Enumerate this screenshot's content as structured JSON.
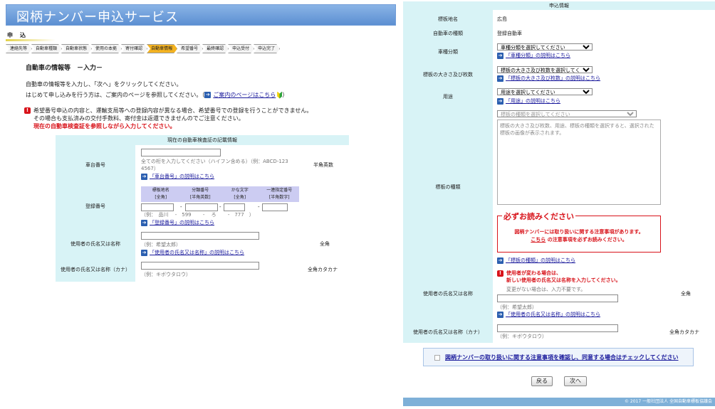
{
  "left": {
    "banner_title": "図柄ナンバー申込サービス",
    "apply_label": "申込",
    "steps": [
      "連絡先等",
      "自動車種類",
      "自動車状態",
      "使用の本拠",
      "寄付確認",
      "自動車情報",
      "希望番号",
      "最終確認",
      "申込受付",
      "申込完了"
    ],
    "active_step_index": 5,
    "heading": "自動車の情報等　－入力－",
    "intro1": "自動車の情報等を入力し、「次へ」をクリックしてください。",
    "intro2": "はじめて申し込みを行う方は、ご案内のページを参照してください。（",
    "intro2_link": "ご案内のページはこちら",
    "warn1": "希望番号申込の内容と、運輸支局等への登録内容が異なる場合、希望番号での登録を行うことができません。",
    "warn2": "その場合も支払済みの交付手数料、寄付金は返還できませんのでご注意ください。",
    "warn3": "現在の自動車検査証を参照しながら入力してください。",
    "form_header": "現在の自動車検査証の記載情報",
    "chassis": {
      "label": "車台番号",
      "value": "",
      "hint": "全ての桁を入力してください（ハイフン含める）（例：ABCD-123",
      "hint2": "4567）",
      "help_link": "「車台番号」の説明はこちら",
      "note": "半角英数"
    },
    "registration": {
      "label": "登録番号",
      "columns": [
        {
          "name": "標板地名",
          "type": "[全角]"
        },
        {
          "name": "分類番号",
          "type": "[半角英数]"
        },
        {
          "name": "かな文字",
          "type": "[全角]"
        },
        {
          "name": "一連指定番号",
          "type": "[半角数字]"
        }
      ],
      "separator": "-",
      "example": "（例：　品川　 -　599　　 -　 ろ　　 -　777　）",
      "help_link": "「登録番号」の説明はこちら"
    },
    "user_name": {
      "label": "使用者の氏名又は名称",
      "example": "（例：希望太郎）",
      "help_link": "「使用者の氏名又は名称」の説明はこちら",
      "note": "全角"
    },
    "user_kana": {
      "label": "使用者の氏名又は名称（カナ）",
      "example": "（例：キボウタロウ）",
      "note": "全角カタカナ"
    }
  },
  "right": {
    "header": "申込情報",
    "plate_region": {
      "label": "標板地名",
      "value": "広島"
    },
    "vehicle_type": {
      "label": "自動車の種類",
      "value": "登録自動車"
    },
    "vehicle_class": {
      "label": "車種分類",
      "select": "車種分類を選択してください",
      "help_link": "「車種分類」の説明はこちら"
    },
    "plate_size": {
      "label": "標板の大きさ及び枚数",
      "select": "標板の大きさ及び枚数を選択してく",
      "help_link": "「標板の大きさ及び枚数」の説明はこちら"
    },
    "usage": {
      "label": "用途",
      "select": "用途を選択してください",
      "help_link": "「用途」の説明はこちら"
    },
    "plate_type": {
      "label": "標板の種類",
      "select": "標板の種類を選択してください",
      "preview_text": "標板の大きさ及び枚数、用途、標板の種類を選択すると、選択された標板の画像が表示されます。",
      "help_link": "「標板の種類」の説明はこちら"
    },
    "must_read": {
      "title": "必ずお読みください",
      "line1": "図柄ナンバーには取り扱いに関する注意事項があります。",
      "link": "こちら",
      "line2": " の注意事項を必ずお読みください。"
    },
    "user_name": {
      "label": "使用者の氏名又は名称",
      "warn1": "使用者が変わる場合は、",
      "warn2": "新しい使用者の氏名又は名称を入力してください。",
      "hint": "変更がない場合は、入力不要です。",
      "example": "（例：希望太郎）",
      "help_link": "「使用者の氏名又は名称」の説明はこちら",
      "note": "全角"
    },
    "user_kana": {
      "label": "使用者の氏名又は名称（カナ）",
      "example": "（例：キボウタロウ）",
      "note": "全角カタカナ"
    },
    "agree_text": "図柄ナンバーの取り扱いに関する注意事項を確認し、同意する場合はチェックしてください",
    "back_label": "戻る",
    "next_label": "次へ",
    "footer": "© 2017 一般社団法人 全国自動車標板協議会"
  },
  "colors": {
    "accent_blue": "#5c8fd2",
    "active_step": "#f4b321",
    "label_bg": "#d8f3f6",
    "warn_red": "#d8131a"
  }
}
